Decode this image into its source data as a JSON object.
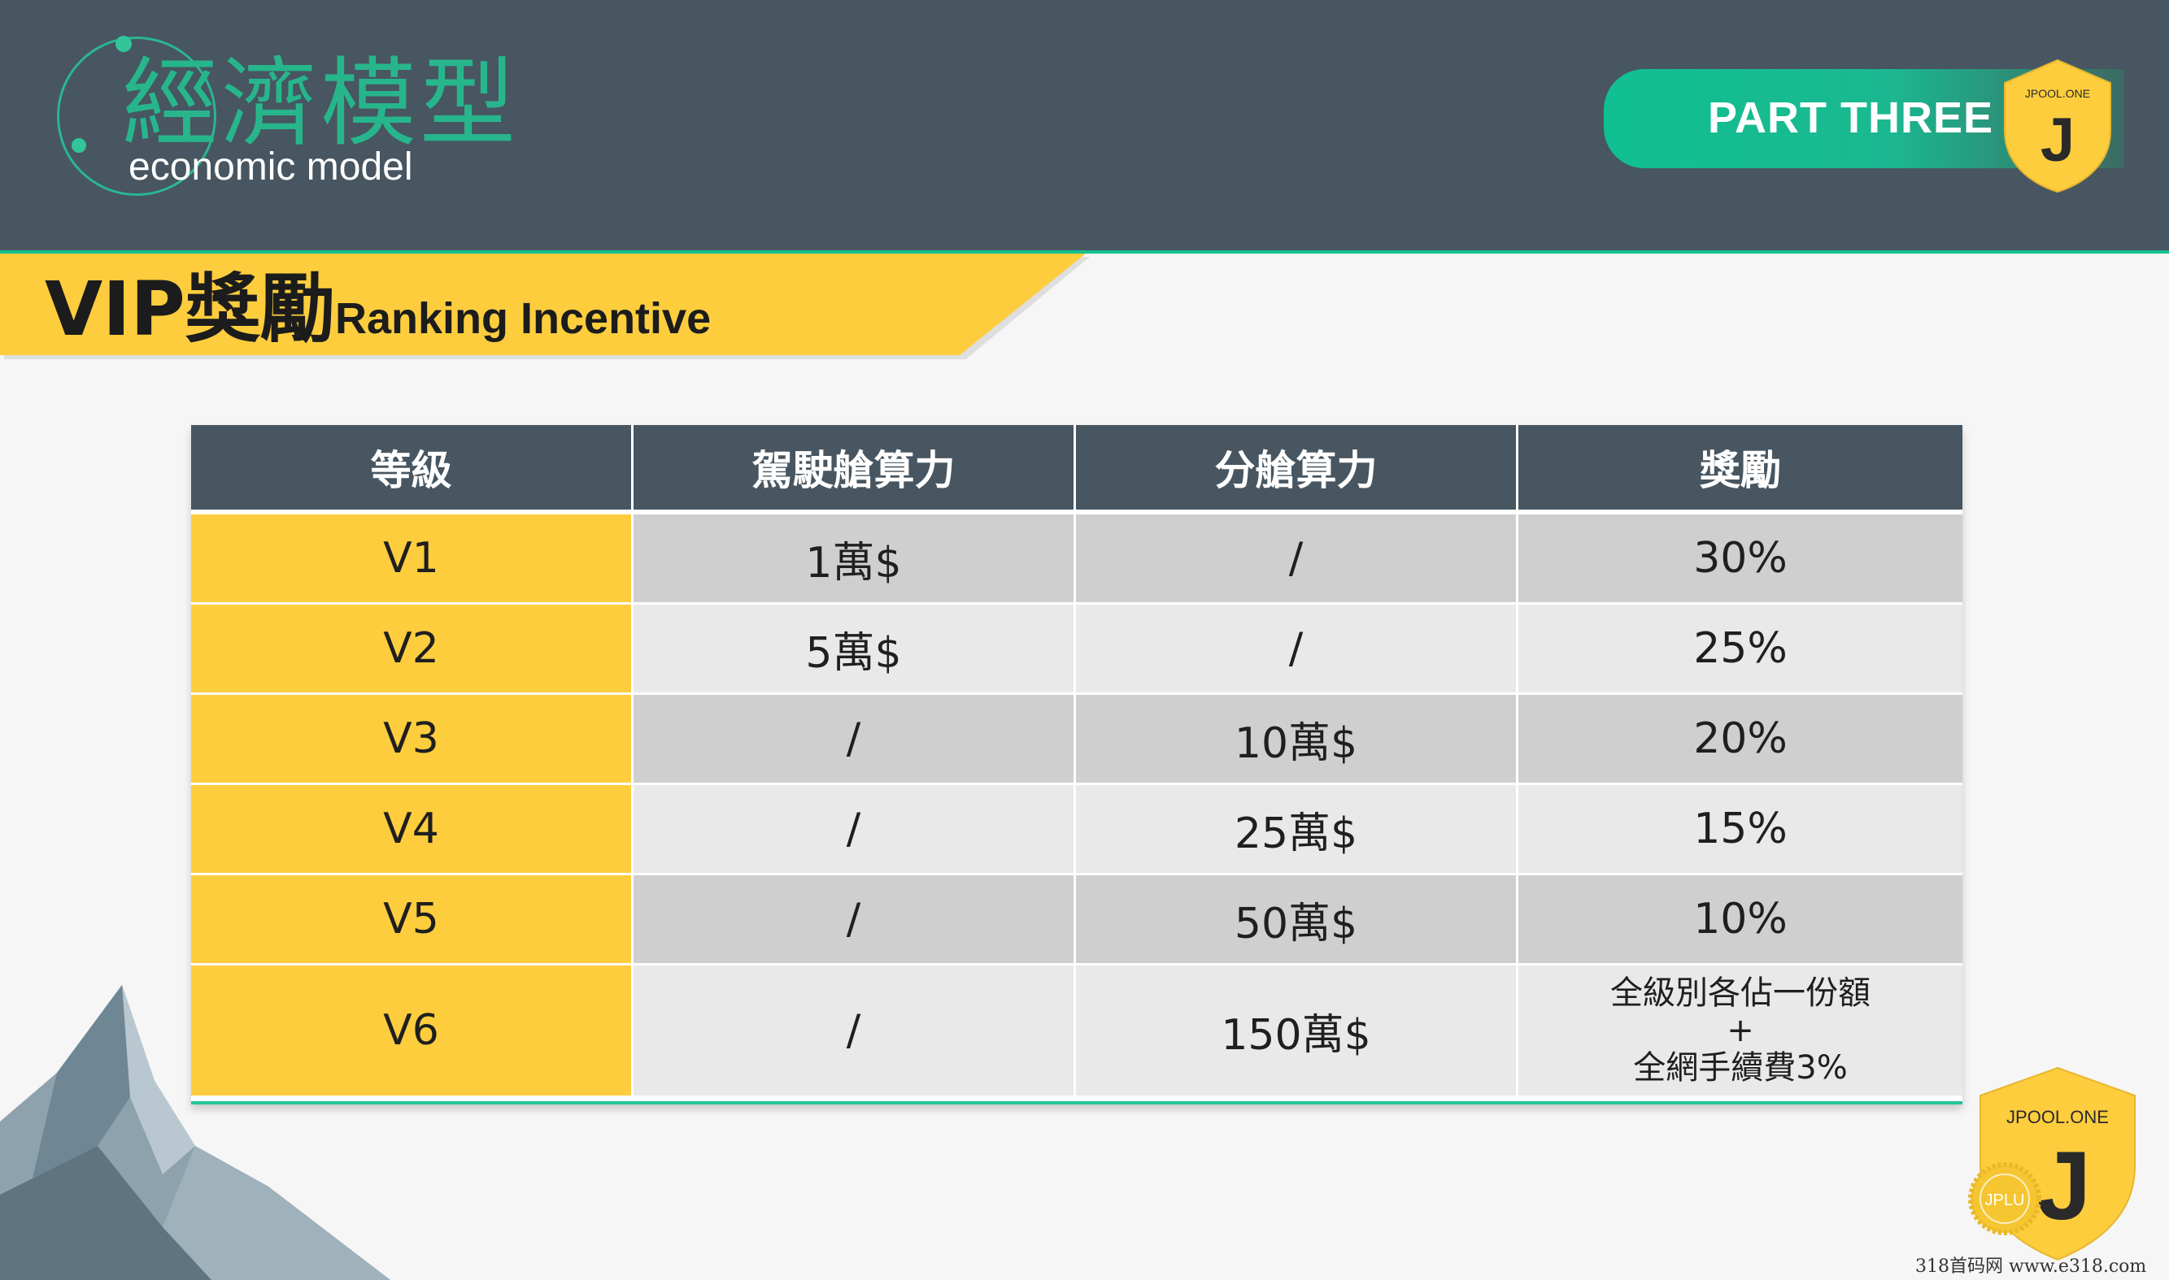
{
  "header": {
    "title_cn": "經濟模型",
    "title_en": "economic model",
    "part_label": "PART THREE",
    "badge_text": "JPOOL.ONE",
    "badge_letter": "J"
  },
  "section": {
    "title": "VIP獎勵",
    "subtitle": "Ranking Incentive"
  },
  "table": {
    "headers": [
      "等級",
      "駕駛艙算力",
      "分艙算力",
      "獎勵"
    ],
    "rows": [
      {
        "level": "V1",
        "cockpit": "1萬$",
        "cabin": "/",
        "reward": "30%"
      },
      {
        "level": "V2",
        "cockpit": "5萬$",
        "cabin": "/",
        "reward": "25%"
      },
      {
        "level": "V3",
        "cockpit": "/",
        "cabin": "10萬$",
        "reward": "20%"
      },
      {
        "level": "V4",
        "cockpit": "/",
        "cabin": "25萬$",
        "reward": "15%"
      },
      {
        "level": "V5",
        "cockpit": "/",
        "cabin": "50萬$",
        "reward": "10%"
      },
      {
        "level": "V6",
        "cockpit": "/",
        "cabin": "150萬$",
        "reward_lines": [
          "全級別各佔一份額",
          "+",
          "全網手續費3%"
        ]
      }
    ]
  },
  "footer_badge": {
    "text": "JPOOL.ONE",
    "letter": "J",
    "seal_text": "JPLU"
  },
  "watermark": "318首码网   www.e318.com",
  "colors": {
    "header_bg": "#475661",
    "accent_green": "#16c08f",
    "accent_yellow": "#fdcd3e"
  }
}
